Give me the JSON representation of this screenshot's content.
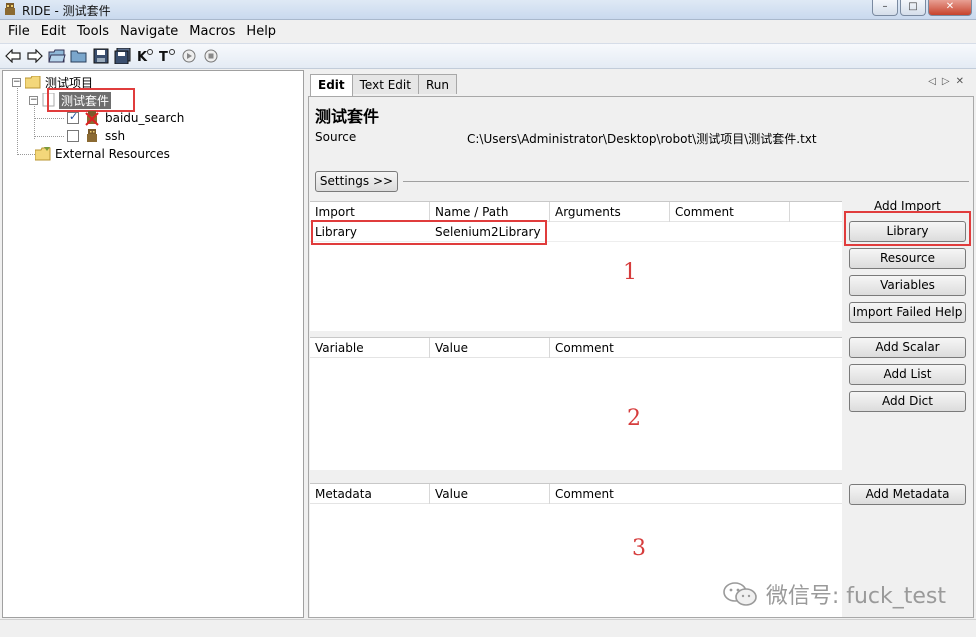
{
  "window": {
    "title": "RIDE - 测试套件"
  },
  "menu": [
    "File",
    "Edit",
    "Tools",
    "Navigate",
    "Macros",
    "Help"
  ],
  "toolbar": {
    "icons": [
      "back-icon",
      "forward-icon",
      "open-icon",
      "open-folder-icon",
      "save-icon",
      "save-all-icon",
      "search-keyword-icon",
      "search-test-icon",
      "run-icon",
      "stop-icon"
    ]
  },
  "tree": {
    "root": "测试项目",
    "suite": "测试套件",
    "tests": [
      "baidu_search",
      "ssh"
    ],
    "external": "External Resources"
  },
  "tabs": [
    "Edit",
    "Text Edit",
    "Run"
  ],
  "editor": {
    "suite_title": "测试套件",
    "source_label": "Source",
    "source_path": "C:\\Users\\Administrator\\Desktop\\robot\\测试项目\\测试套件.txt",
    "settings_button": "Settings >>",
    "add_import_label": "Add Import",
    "import_grid": {
      "headers": [
        "Import",
        "Name / Path",
        "Arguments",
        "Comment"
      ],
      "rows": [
        [
          "Library",
          "Selenium2Library",
          "",
          ""
        ]
      ]
    },
    "variable_grid": {
      "headers": [
        "Variable",
        "Value",
        "Comment"
      ]
    },
    "metadata_grid": {
      "headers": [
        "Metadata",
        "Value",
        "Comment"
      ]
    },
    "buttons": {
      "library": "Library",
      "resource": "Resource",
      "variables": "Variables",
      "import_failed_help": "Import Failed Help",
      "add_scalar": "Add Scalar",
      "add_list": "Add List",
      "add_dict": "Add Dict",
      "add_metadata": "Add Metadata"
    }
  },
  "annotations": [
    "1",
    "2",
    "3"
  ],
  "watermark": "微信号: fuck_test",
  "colors": {
    "highlight_red": "#e03c3c",
    "selection_gray": "#6e6e6e"
  }
}
